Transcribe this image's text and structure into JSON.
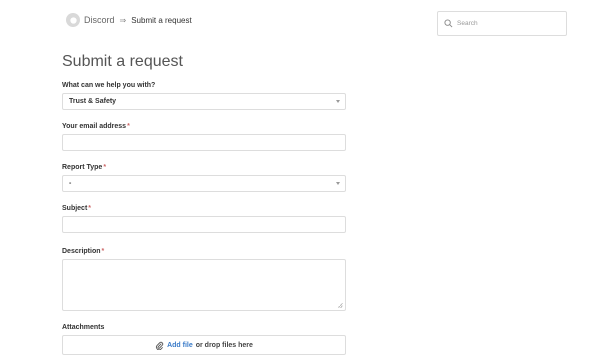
{
  "breadcrumb": {
    "home": "Discord",
    "separator": "⇒",
    "current": "Submit a request"
  },
  "search": {
    "placeholder": "Search"
  },
  "page": {
    "title": "Submit a request"
  },
  "form": {
    "help_topic": {
      "label": "What can we help you with?",
      "value": "Trust & Safety"
    },
    "email": {
      "label": "Your email address",
      "required_mark": "*",
      "value": ""
    },
    "report_type": {
      "label": "Report Type",
      "required_mark": "*",
      "value": "-"
    },
    "subject": {
      "label": "Subject",
      "required_mark": "*",
      "value": ""
    },
    "description": {
      "label": "Description",
      "required_mark": "*",
      "value": ""
    },
    "attachments": {
      "label": "Attachments",
      "add_file": "Add file",
      "drop_text": "or drop files here"
    }
  },
  "colors": {
    "link": "#3a7bc8",
    "required": "#cc6666",
    "border": "#dddddd"
  }
}
